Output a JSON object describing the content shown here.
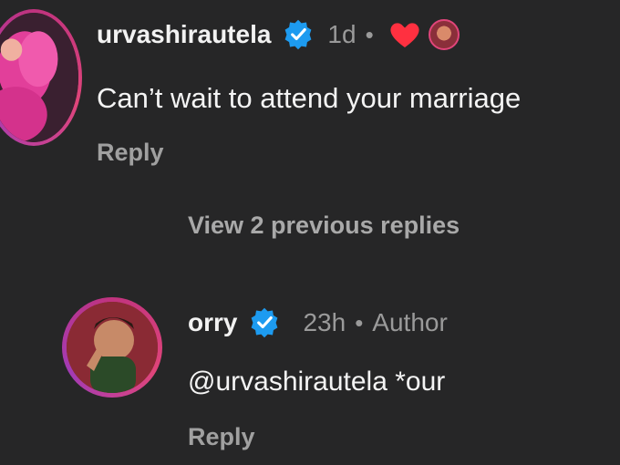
{
  "comments": [
    {
      "username": "urvashirautela",
      "time": "1d",
      "separator": "•",
      "text": "Can’t wait to attend your marriage",
      "reply_label": "Reply",
      "liked_by_author": true
    }
  ],
  "view_replies_label": "View 2 previous replies",
  "reply": {
    "username": "orry",
    "time": "23h",
    "separator": "•",
    "author_label": "Author",
    "text": "@urvashirautela *our",
    "reply_label": "Reply"
  },
  "colors": {
    "background": "#262627",
    "verified": "#1d9bf0",
    "heart": "#ff3040",
    "avatar_ring": "#c0337e",
    "secondary_text": "#9a9a9a"
  },
  "icons": {
    "verified": "verified-badge-icon",
    "heart": "heart-icon"
  }
}
